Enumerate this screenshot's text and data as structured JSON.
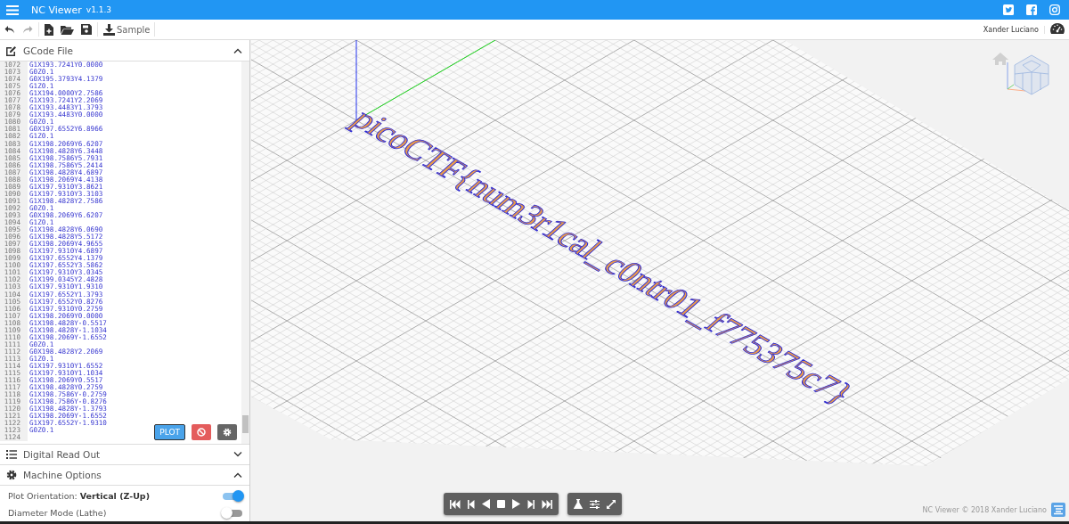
{
  "app": {
    "title": "NC Viewer",
    "version": "v1.1.3"
  },
  "toolbar": {
    "sample_label": "Sample",
    "user": "Xander Luciano"
  },
  "gcode_panel": {
    "title": "GCode File",
    "expanded": true,
    "plot_button": "PLOT",
    "lines": [
      {
        "number": "1072",
        "code": "G1X193.7241Y0.0000"
      },
      {
        "number": "1073",
        "code": "G0Z0.1"
      },
      {
        "number": "1074",
        "code": "G0X195.3793Y4.1379"
      },
      {
        "number": "1075",
        "code": "G1Z0.1"
      },
      {
        "number": "1076",
        "code": "G1X194.0000Y2.7586"
      },
      {
        "number": "1077",
        "code": "G1X193.7241Y2.2069"
      },
      {
        "number": "1078",
        "code": "G1X193.4483Y1.3793"
      },
      {
        "number": "1079",
        "code": "G1X193.4483Y0.0000"
      },
      {
        "number": "1080",
        "code": "G0Z0.1"
      },
      {
        "number": "1081",
        "code": "G0X197.6552Y6.8966"
      },
      {
        "number": "1082",
        "code": "G1Z0.1"
      },
      {
        "number": "1083",
        "code": "G1X198.2069Y6.6207"
      },
      {
        "number": "1084",
        "code": "G1X198.4828Y6.3448"
      },
      {
        "number": "1085",
        "code": "G1X198.7586Y5.7931"
      },
      {
        "number": "1086",
        "code": "G1X198.7586Y5.2414"
      },
      {
        "number": "1087",
        "code": "G1X198.4828Y4.6897"
      },
      {
        "number": "1088",
        "code": "G1X198.2069Y4.4138"
      },
      {
        "number": "1089",
        "code": "G1X197.9310Y3.8621"
      },
      {
        "number": "1090",
        "code": "G1X197.9310Y3.3103"
      },
      {
        "number": "1091",
        "code": "G1X198.4828Y2.7586"
      },
      {
        "number": "1092",
        "code": "G0Z0.1"
      },
      {
        "number": "1093",
        "code": "G0X198.2069Y6.6207"
      },
      {
        "number": "1094",
        "code": "G1Z0.1"
      },
      {
        "number": "1095",
        "code": "G1X198.4828Y6.0690"
      },
      {
        "number": "1096",
        "code": "G1X198.4828Y5.5172"
      },
      {
        "number": "1097",
        "code": "G1X198.2069Y4.9655"
      },
      {
        "number": "1098",
        "code": "G1X197.9310Y4.6897"
      },
      {
        "number": "1099",
        "code": "G1X197.6552Y4.1379"
      },
      {
        "number": "1100",
        "code": "G1X197.6552Y3.5862"
      },
      {
        "number": "1101",
        "code": "G1X197.9310Y3.0345"
      },
      {
        "number": "1102",
        "code": "G1X199.0345Y2.4828"
      },
      {
        "number": "1103",
        "code": "G1X197.9310Y1.9310"
      },
      {
        "number": "1104",
        "code": "G1X197.6552Y1.3793"
      },
      {
        "number": "1105",
        "code": "G1X197.6552Y0.8276"
      },
      {
        "number": "1106",
        "code": "G1X197.9310Y0.2759"
      },
      {
        "number": "1107",
        "code": "G1X198.2069Y0.0000"
      },
      {
        "number": "1108",
        "code": "G1X198.4828Y-0.5517"
      },
      {
        "number": "1109",
        "code": "G1X198.4828Y-1.1034"
      },
      {
        "number": "1110",
        "code": "G1X198.2069Y-1.6552"
      },
      {
        "number": "1111",
        "code": "G0Z0.1"
      },
      {
        "number": "1112",
        "code": "G0X198.4828Y2.2069"
      },
      {
        "number": "1113",
        "code": "G1Z0.1"
      },
      {
        "number": "1114",
        "code": "G1X197.9310Y1.6552"
      },
      {
        "number": "1115",
        "code": "G1X197.9310Y1.1034"
      },
      {
        "number": "1116",
        "code": "G1X198.2069Y0.5517"
      },
      {
        "number": "1117",
        "code": "G1X198.4828Y0.2759"
      },
      {
        "number": "1118",
        "code": "G1X198.7586Y-0.2759"
      },
      {
        "number": "1119",
        "code": "G1X198.7586Y-0.8276"
      },
      {
        "number": "1120",
        "code": "G1X198.4828Y-1.3793"
      },
      {
        "number": "1121",
        "code": "G1X198.2069Y-1.6552"
      },
      {
        "number": "1122",
        "code": "G1X197.6552Y-1.9310"
      },
      {
        "number": "1123",
        "code": "G0Z0.1"
      },
      {
        "number": "1124"
      }
    ]
  },
  "dro_panel": {
    "title": "Digital Read Out",
    "expanded": false
  },
  "machine_panel": {
    "title": "Machine Options",
    "expanded": true,
    "options": [
      {
        "label": "Plot Orientation: **Vertical (Z-Up)**",
        "on": true
      },
      {
        "label": "Diameter Mode (Lathe)",
        "on": false
      }
    ]
  },
  "viewport": {
    "plot_text": "picoCTF{num3r1cal_c0ntr01_f775375c7}"
  },
  "footer": {
    "credit": "NC Viewer © 2018 Xander Luciano"
  }
}
